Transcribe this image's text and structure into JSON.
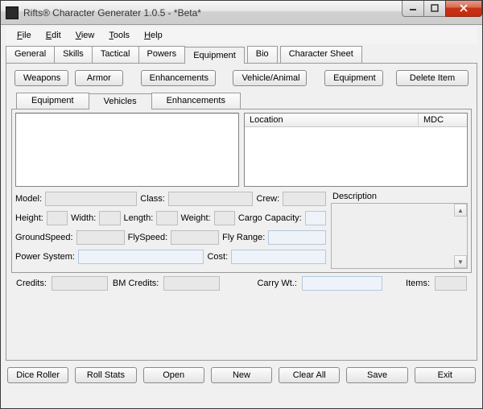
{
  "window": {
    "title": "Rifts® Character Generater 1.0.5 - *Beta*"
  },
  "menu": {
    "file": "File",
    "edit": "Edit",
    "view": "View",
    "tools": "Tools",
    "help": "Help"
  },
  "mainTabs": {
    "general": "General",
    "skills": "Skills",
    "tactical": "Tactical",
    "powers": "Powers",
    "equipment": "Equipment",
    "bio": "Bio",
    "sheet": "Character Sheet"
  },
  "catButtons": {
    "weapons": "Weapons",
    "armor": "Armor",
    "enhancements": "Enhancements",
    "vehicle": "Vehicle/Animal",
    "equipment": "Equipment",
    "delete": "Delete Item"
  },
  "subTabs": {
    "equipment": "Equipment",
    "vehicles": "Vehicles",
    "enhancements": "Enhancements"
  },
  "tableHead": {
    "location": "Location",
    "mdc": "MDC"
  },
  "labels": {
    "model": "Model:",
    "class": "Class:",
    "crew": "Crew:",
    "height": "Height:",
    "width": "Width:",
    "length": "Length:",
    "weight": "Weight:",
    "cargo": "Cargo Capacity:",
    "groundspeed": "GroundSpeed:",
    "flyspeed": "FlySpeed:",
    "flyrange": "Fly Range:",
    "powersystem": "Power System:",
    "cost": "Cost:",
    "description": "Description"
  },
  "bottom": {
    "credits": "Credits:",
    "bmcredits": "BM Credits:",
    "carrywt": "Carry Wt.:",
    "items": "Items:"
  },
  "footer": {
    "dice": "Dice Roller",
    "roll": "Roll Stats",
    "open": "Open",
    "new": "New",
    "clear": "Clear All",
    "save": "Save",
    "exit": "Exit"
  },
  "values": {
    "model": "",
    "class": "",
    "crew": "",
    "height": "",
    "width": "",
    "length": "",
    "weight": "",
    "cargo": "",
    "groundspeed": "",
    "flyspeed": "",
    "flyrange": "",
    "powersystem": "",
    "cost": "",
    "credits": "",
    "bmcredits": "",
    "carrywt": "",
    "items": ""
  }
}
